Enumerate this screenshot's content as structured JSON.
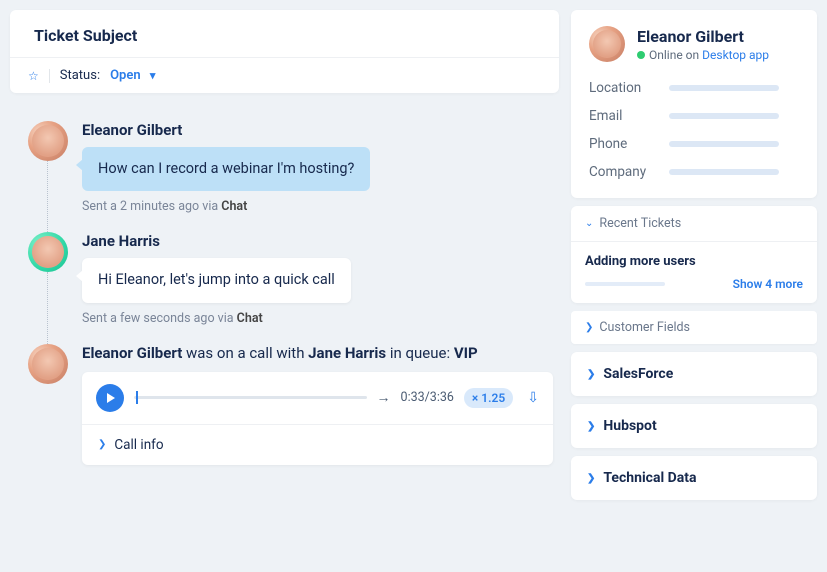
{
  "header": {
    "title": "Ticket Subject",
    "status_label": "Status:",
    "status_value": "Open"
  },
  "thread": [
    {
      "author": "Eleanor Gilbert",
      "text": "How can I record a webinar I'm hosting?",
      "meta_prefix": "Sent a 2 minutes ago via ",
      "channel": "Chat"
    },
    {
      "author": "Jane Harris",
      "text": "Hi Eleanor, let's jump into a quick call",
      "meta_prefix": "Sent a few seconds ago via ",
      "channel": "Chat"
    }
  ],
  "call_event": {
    "subject": "Eleanor Gilbert",
    "phrase_mid": " was on a call with ",
    "agent": "Jane Harris",
    "phrase_tail": " in queue: ",
    "queue": "VIP",
    "time_display": "0:33/3:36",
    "speed": "× 1.25",
    "info_label": "Call info"
  },
  "profile": {
    "name": "Eleanor Gilbert",
    "status_prefix": "Online on ",
    "status_app": "Desktop app",
    "fields": {
      "location": "Location",
      "email": "Email",
      "phone": "Phone",
      "company": "Company"
    }
  },
  "panels": {
    "recent_tickets": "Recent Tickets",
    "recent_ticket_title": "Adding more users",
    "show_more": "Show 4 more",
    "customer_fields": "Customer Fields",
    "salesforce": "SalesForce",
    "hubspot": "Hubspot",
    "technical_data": "Technical Data"
  }
}
